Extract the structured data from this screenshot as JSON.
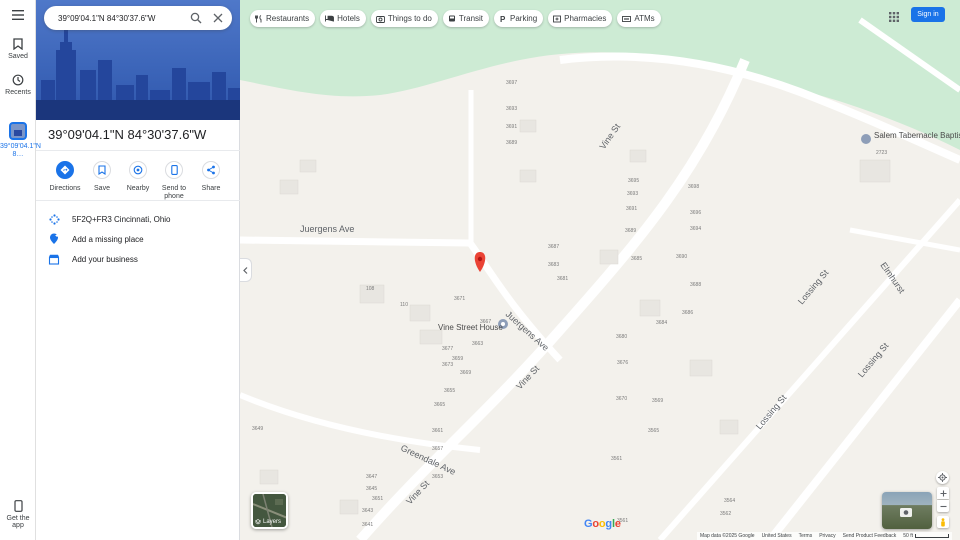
{
  "search": {
    "value": "39°09'04.1\"N 84°30'37.6\"W"
  },
  "rail": {
    "saved_label": "Saved",
    "recents_label": "Recents",
    "place_label": "39°09'04.1\"N 8…",
    "get_app_label": "Get the app"
  },
  "panel": {
    "title": "39°09'04.1\"N 84°30'37.6\"W",
    "actions": [
      {
        "label": "Directions",
        "icon": "directions-icon"
      },
      {
        "label": "Save",
        "icon": "bookmark-icon"
      },
      {
        "label": "Nearby",
        "icon": "nearby-icon"
      },
      {
        "label": "Send to phone",
        "icon": "phone-icon"
      },
      {
        "label": "Share",
        "icon": "share-icon"
      }
    ],
    "rows": [
      {
        "label": "5F2Q+FR3 Cincinnati, Ohio",
        "icon": "plus-code-icon"
      },
      {
        "label": "Add a missing place",
        "icon": "add-place-icon"
      },
      {
        "label": "Add your business",
        "icon": "business-icon"
      }
    ]
  },
  "chips": [
    {
      "label": "Restaurants",
      "icon": "restaurant-icon"
    },
    {
      "label": "Hotels",
      "icon": "hotel-icon"
    },
    {
      "label": "Things to do",
      "icon": "camera-icon"
    },
    {
      "label": "Transit",
      "icon": "transit-icon"
    },
    {
      "label": "Parking",
      "icon": "parking-icon"
    },
    {
      "label": "Pharmacies",
      "icon": "pharmacy-icon"
    },
    {
      "label": "ATMs",
      "icon": "atm-icon"
    }
  ],
  "header": {
    "sign_in_label": "Sign in"
  },
  "map": {
    "streets": [
      "Juergens Ave",
      "Vine St",
      "Vine St",
      "Vine St",
      "Juergens Ave",
      "Lossing St",
      "Lossing St",
      "Greendale Ave",
      "Elmhurst",
      "Lossing St"
    ],
    "poi": [
      "Vine Street House",
      "Salem Tabernacle Baptist Church"
    ],
    "house_numbers": [
      "3697",
      "3693",
      "3691",
      "3689",
      "3695",
      "3693",
      "3691",
      "3689",
      "3687",
      "3683",
      "3685",
      "3681",
      "3677",
      "3673",
      "3669",
      "3665",
      "3661",
      "3657",
      "3653",
      "3649",
      "3647",
      "3645",
      "3643",
      "3641",
      "3651",
      "3655",
      "3659",
      "3663",
      "3667",
      "3671",
      "108",
      "110",
      "3690",
      "3688",
      "3686",
      "3684",
      "3680",
      "3676",
      "3670",
      "3569",
      "3565",
      "3561",
      "3564",
      "3562",
      "3561",
      "2723",
      "3698",
      "3696",
      "3694"
    ],
    "layers_label": "Layers",
    "google_label": "Google",
    "brand_colors": [
      "#4285f4",
      "#ea4335",
      "#fbbc05",
      "#34a853"
    ]
  },
  "footer": {
    "items": [
      "Map data ©2025 Google",
      "United States",
      "Terms",
      "Privacy",
      "Send Product Feedback"
    ],
    "scale_label": "50 ft"
  },
  "colors": {
    "accent": "#1a73e8",
    "pin": "#ea4335",
    "road": "#ffffff",
    "park": "#cdebd4"
  }
}
